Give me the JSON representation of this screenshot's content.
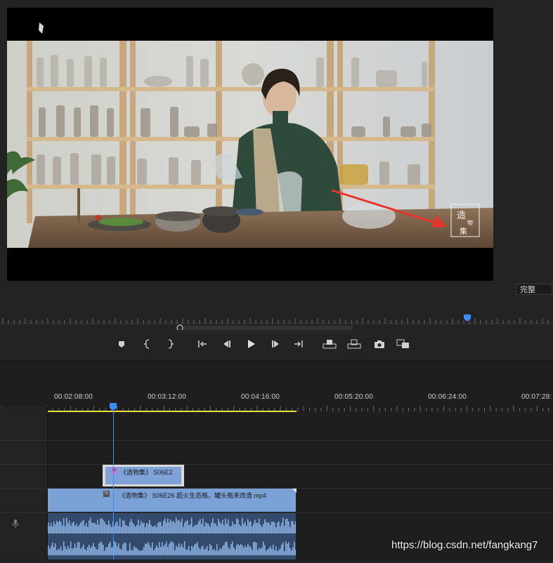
{
  "monitor": {
    "zoom_level": "完整",
    "video": {
      "watermark_chars": [
        "造",
        "物",
        "集"
      ],
      "annotation_arrow_color": "#e8342b"
    }
  },
  "transport": {
    "buttons": [
      {
        "name": "add-marker-button",
        "icon": "marker-icon"
      },
      {
        "name": "mark-in-button",
        "icon": "mark-in-icon"
      },
      {
        "name": "mark-out-button",
        "icon": "mark-out-icon"
      },
      {
        "name": "go-to-in-button",
        "icon": "go-to-in-icon"
      },
      {
        "name": "step-back-button",
        "icon": "step-back-icon"
      },
      {
        "name": "play-button",
        "icon": "play-icon"
      },
      {
        "name": "step-forward-button",
        "icon": "step-forward-icon"
      },
      {
        "name": "go-to-out-button",
        "icon": "go-to-out-icon"
      },
      {
        "name": "lift-button",
        "icon": "lift-icon"
      },
      {
        "name": "extract-button",
        "icon": "extract-icon"
      },
      {
        "name": "export-frame-button",
        "icon": "camera-icon"
      },
      {
        "name": "comparison-view-button",
        "icon": "comparison-icon"
      }
    ]
  },
  "timeline": {
    "timecodes": [
      "00:02:08:00",
      "00:03:12:00",
      "00:04:16:00",
      "00:05:20:00",
      "00:06:24:00",
      "00:07:28:"
    ],
    "clips": {
      "v2_title": "《造物集》 S06E2",
      "v1_title": "《造物集》 S06E26 超火生态瓶，罐头瓶来改造.mp4",
      "fx_badge": "fx"
    },
    "playhead_color": "#3d8bff",
    "work_area_color": "#e8e23a"
  },
  "watermark_url": "https://blog.csdn.net/fangkang7"
}
